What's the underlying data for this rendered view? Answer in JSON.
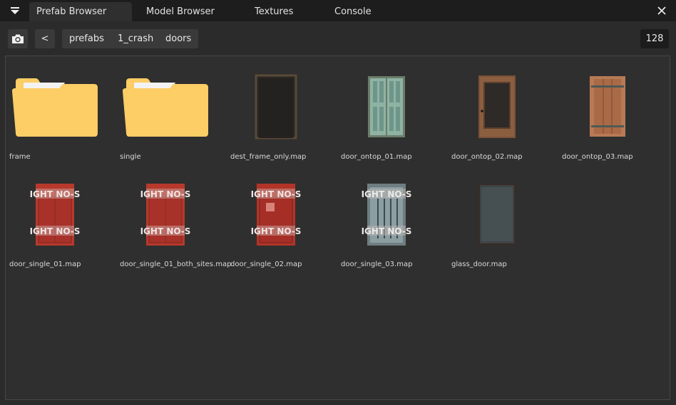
{
  "tabs": [
    "Prefab Browser",
    "Model Browser",
    "Textures",
    "Console"
  ],
  "toolbar": {
    "back_label": "<",
    "breadcrumbs": [
      "prefabs",
      "1_crash",
      "doors"
    ],
    "count": "128"
  },
  "items": [
    {
      "name": "frame",
      "kind": "folder"
    },
    {
      "name": "single",
      "kind": "folder"
    },
    {
      "name": "dest_frame_only.map",
      "kind": "frame"
    },
    {
      "name": "door_ontop_01.map",
      "kind": "green-door"
    },
    {
      "name": "door_ontop_02.map",
      "kind": "wood-glass-door"
    },
    {
      "name": "door_ontop_03.map",
      "kind": "wood-door"
    },
    {
      "name": "door_single_01.map",
      "kind": "red-sign-door"
    },
    {
      "name": "door_single_01_both_sites.map",
      "kind": "red-sign-door"
    },
    {
      "name": "door_single_02.map",
      "kind": "red-sign-grate-door"
    },
    {
      "name": "door_single_03.map",
      "kind": "glass-sign-door"
    },
    {
      "name": "glass_door.map",
      "kind": "glass-door"
    }
  ],
  "sign_text": "IGHT NO-S",
  "colors": {
    "folder": "#fdcd66",
    "folder_paper": "#f2f2f2",
    "active_tab": "#2f2f2f",
    "panel": "#2f2f2f"
  }
}
